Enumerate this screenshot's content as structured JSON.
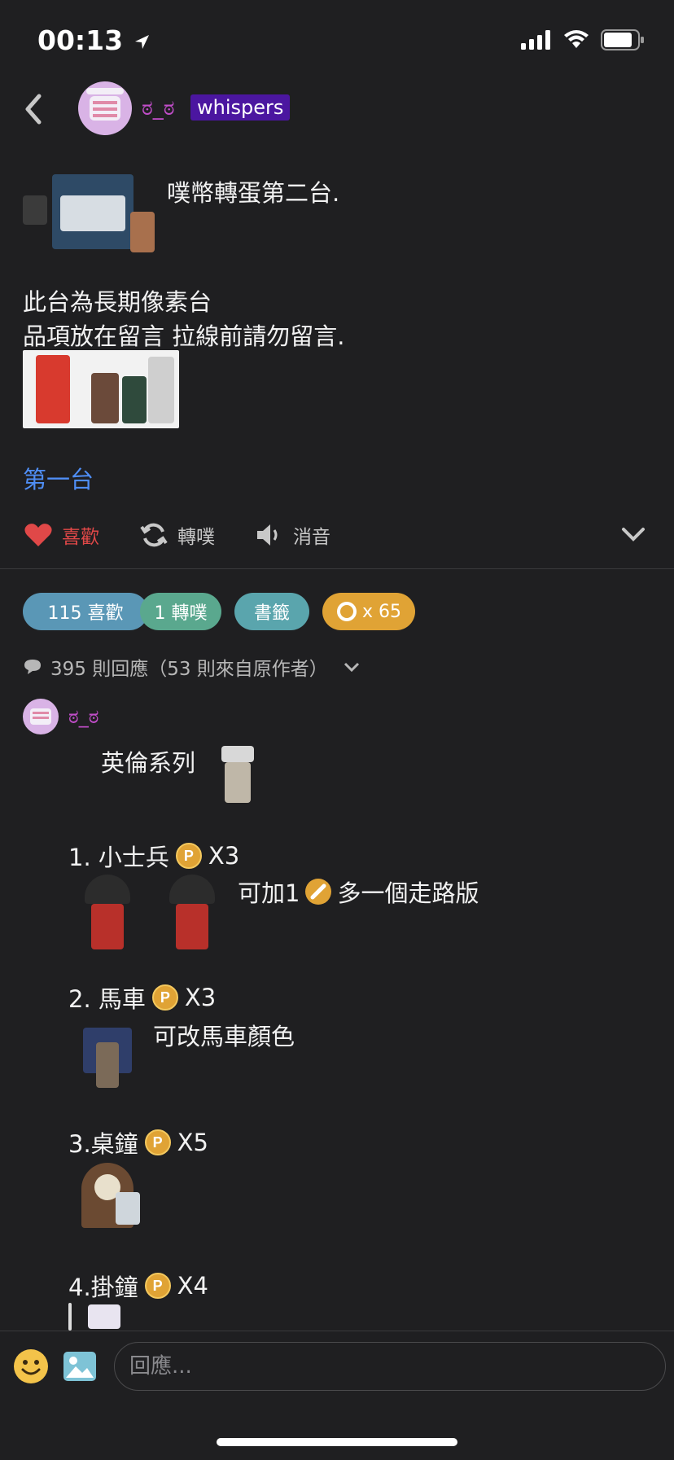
{
  "status_bar": {
    "time": "00:13"
  },
  "header": {
    "author_name": "ಠ_ಠ",
    "badge": "whispers"
  },
  "post": {
    "line1": "噗幣轉蛋第二台.",
    "line2": "此台為長期像素台",
    "line3": "品項放在留言 拉線前請勿留言.",
    "link": "第一台"
  },
  "actions": {
    "like": "喜歡",
    "replurk": "轉噗",
    "mute": "消音"
  },
  "stats": {
    "likes": "115 喜歡",
    "replurks": "1 轉噗",
    "bookmark": "書籤",
    "coins": "x 65"
  },
  "replies": {
    "summary": "395 則回應（53 則來自原作者）"
  },
  "comment": {
    "author": "ಠ_ಠ",
    "series": "英倫系列",
    "item1_title": "1. 小士兵",
    "item1_qty": "X3",
    "item1_note_a": "可加1",
    "item1_note_b": "多一個走路版",
    "item2_title": "2. 馬車",
    "item2_qty": "X3",
    "item2_note": "可改馬車顏色",
    "item3_title": "3.桌鐘",
    "item3_qty": "X5",
    "item4_title": "4.掛鐘",
    "item4_qty": "X4"
  },
  "composer": {
    "placeholder": "回應..."
  },
  "colors": {
    "accent_name": "#c04dc8",
    "link": "#4f8ef5",
    "like": "#e04848",
    "badge": "#4b16a0"
  }
}
